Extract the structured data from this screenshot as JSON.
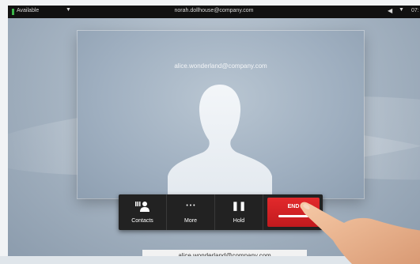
{
  "status_bar": {
    "presence": "Available",
    "self_uri": "norah.dollhouse@company.com",
    "time": "07:"
  },
  "call": {
    "remote_uri": "alice.wonderland@company.com",
    "bottom_label": "alice.wonderland@company.com"
  },
  "controls": {
    "contacts_label": "Contacts",
    "more_label": "More",
    "hold_label": "Hold",
    "end_label": "END"
  },
  "icons": {
    "presence_chevron": "▼",
    "speaker": "◀",
    "volume_chevron": "▼",
    "more": "• • •",
    "hold": "❚❚"
  },
  "colors": {
    "end_button": "#d42225",
    "available": "#3bb54a",
    "status_bar": "#111111"
  }
}
